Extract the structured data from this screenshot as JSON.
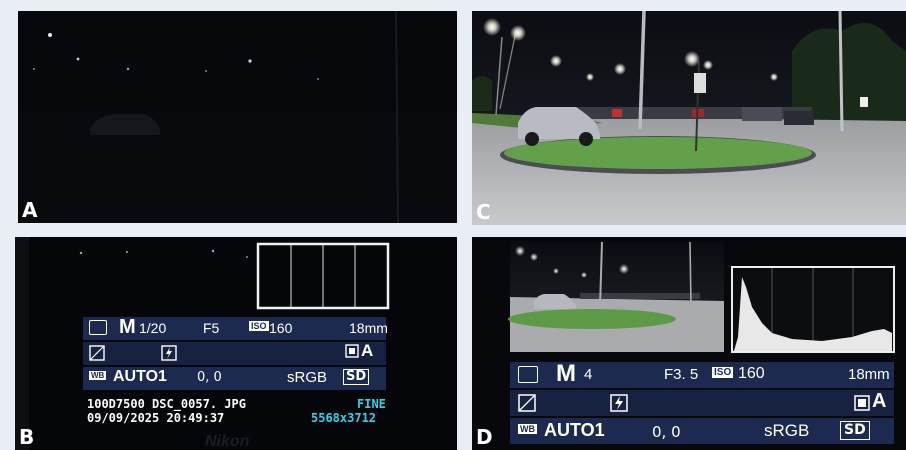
{
  "panels": {
    "A": {
      "label": "A"
    },
    "B": {
      "label": "B"
    },
    "C": {
      "label": "C"
    },
    "D": {
      "label": "D"
    }
  },
  "camera_B": {
    "mode": "M",
    "shutter": "1/20",
    "aperture": "F5",
    "iso_icon": "ISO",
    "iso": "160",
    "focal": "18mm",
    "wb_icon": "WB",
    "wb": "AUTO1",
    "exposure_comp": "0, 0",
    "color_space": "sRGB",
    "picture_ctrl": "SD",
    "active_d": "A",
    "folder_file": "100D7500  DSC_0057. JPG",
    "datetime": "09/09/2025  20:49:37",
    "quality": "FINE",
    "size": "5568x3712",
    "brand": "Nikon"
  },
  "camera_D": {
    "mode": "M",
    "shutter": "4",
    "aperture": "F3. 5",
    "iso_icon": "ISO",
    "iso": "160",
    "focal": "18mm",
    "wb_icon": "WB",
    "wb": "AUTO1",
    "exposure_comp": "0, 0",
    "color_space": "sRGB",
    "picture_ctrl": "SD",
    "active_d": "A"
  }
}
